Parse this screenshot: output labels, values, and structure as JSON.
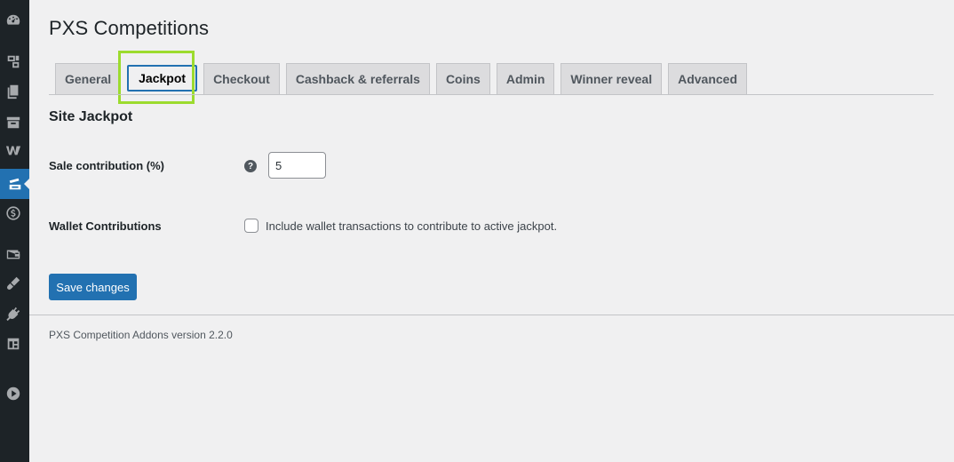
{
  "page": {
    "title": "PXS Competitions"
  },
  "tabs": [
    {
      "label": "General"
    },
    {
      "label": "Jackpot",
      "active": true
    },
    {
      "label": "Checkout"
    },
    {
      "label": "Cashback & referrals"
    },
    {
      "label": "Coins"
    },
    {
      "label": "Admin"
    },
    {
      "label": "Winner reveal"
    },
    {
      "label": "Advanced"
    }
  ],
  "section": {
    "title": "Site Jackpot"
  },
  "fields": {
    "sale_contribution": {
      "label": "Sale contribution (%)",
      "help": "?",
      "value": "5"
    },
    "wallet_contributions": {
      "label": "Wallet Contributions",
      "checkbox_label": "Include wallet transactions to contribute to active jackpot.",
      "checked": false
    }
  },
  "actions": {
    "save_label": "Save changes"
  },
  "footer": {
    "version_text": "PXS Competition Addons version 2.2.0"
  },
  "sidebar": {
    "icons": [
      "dashboard-icon",
      "media-icon",
      "pages-icon",
      "archive-icon",
      "woocommerce-icon",
      "competitions-icon",
      "payments-icon",
      "wallet-icon",
      "appearance-icon",
      "plugins-icon",
      "tools-icon",
      "play-icon"
    ]
  },
  "colors": {
    "accent": "#2271b1",
    "highlight_outline": "#9cdb2e",
    "sidebar_bg": "#1d2327",
    "page_bg": "#f0f0f1"
  }
}
